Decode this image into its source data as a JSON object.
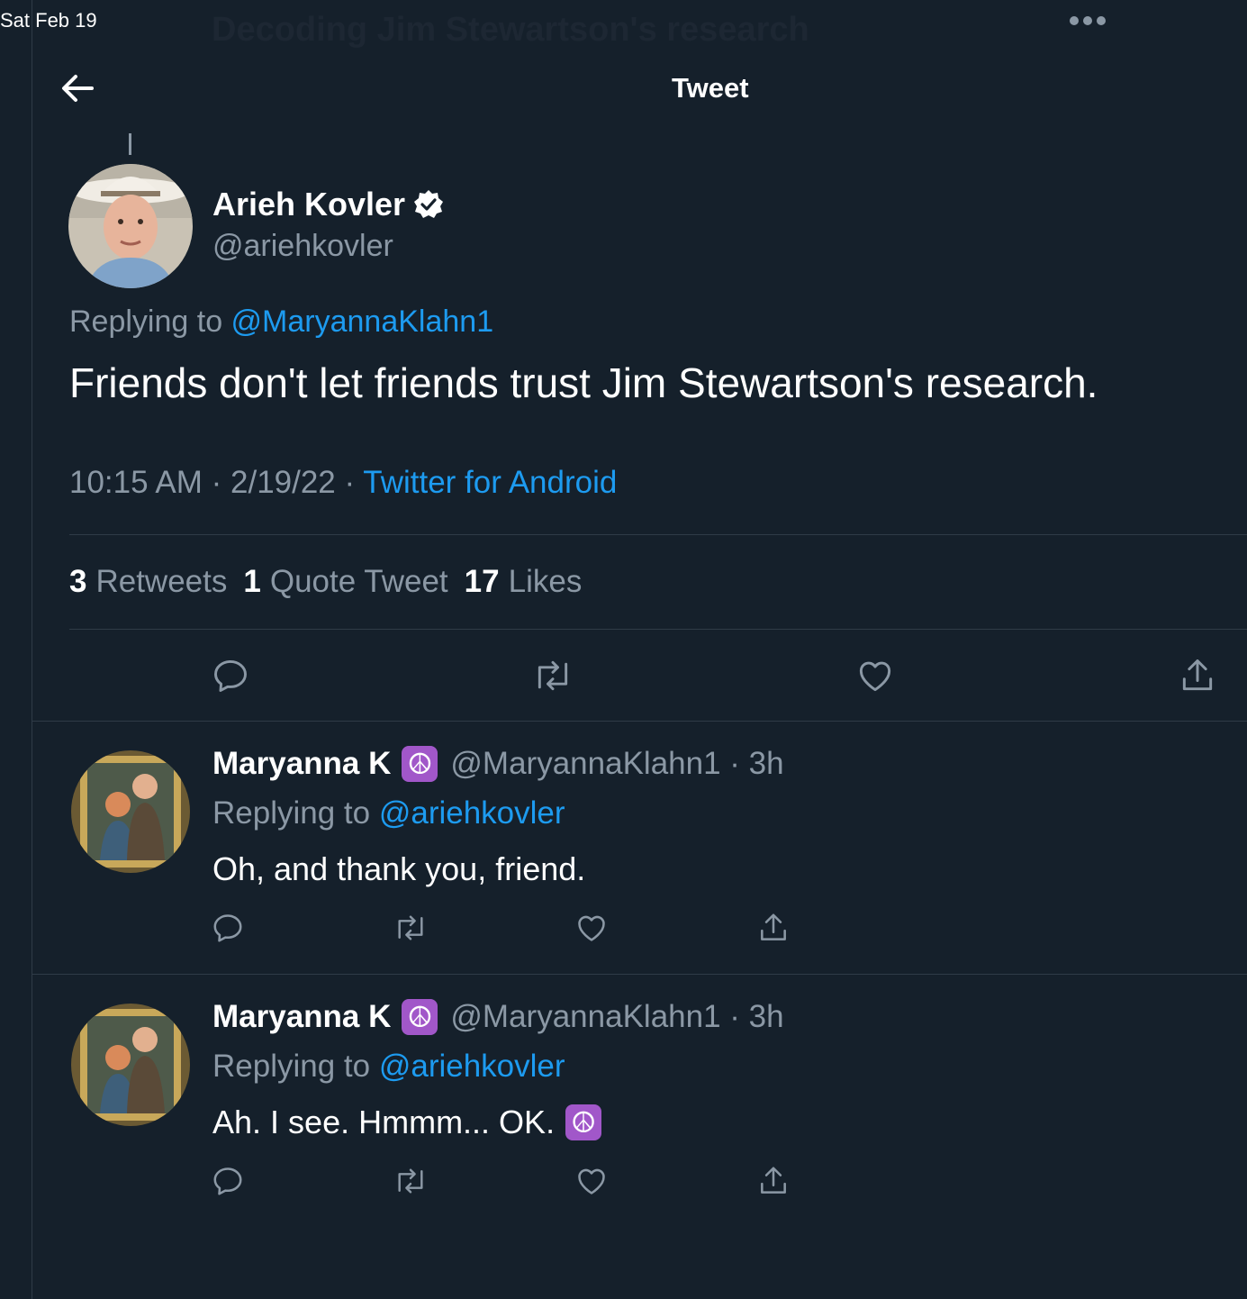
{
  "status_bar": {
    "date": "Sat Feb 19"
  },
  "background_header_text": "Decoding Jim Stewartson's research",
  "header": {
    "title": "Tweet"
  },
  "main_tweet": {
    "author_name": "Arieh Kovler",
    "author_handle": "@ariehkovler",
    "replying_prefix": "Replying to ",
    "replying_to": "@MaryannaKlahn1",
    "text": "Friends don't let friends trust Jim Stewartson's research.",
    "time": "10:15 AM",
    "date": "2/19/22",
    "dot": " · ",
    "source": "Twitter for Android",
    "stats": {
      "retweets_count": "3",
      "retweets_label": "Retweets",
      "quotes_count": "1",
      "quotes_label": "Quote Tweet",
      "likes_count": "17",
      "likes_label": "Likes"
    }
  },
  "replies": [
    {
      "author_name": "Maryanna K",
      "emoji": "☮",
      "handle_time": "@MaryannaKlahn1 · 3h",
      "replying_prefix": "Replying to ",
      "replying_to": "@ariehkovler",
      "text": "Oh, and thank you, friend."
    },
    {
      "author_name": "Maryanna K",
      "emoji": "☮",
      "handle_time": "@MaryannaKlahn1 · 3h",
      "replying_prefix": "Replying to ",
      "replying_to": "@ariehkovler",
      "text": "Ah. I see. Hmmm... OK.",
      "text_emoji": "☮"
    }
  ],
  "colors": {
    "background": "#15202b",
    "accent": "#1d9bf0",
    "muted": "#8b98a5",
    "divider": "#2f3b47",
    "peace_emoji_bg": "#a157c9"
  },
  "icons": [
    "back-arrow-icon",
    "more-icon",
    "verified-badge-icon",
    "reply-icon",
    "retweet-icon",
    "like-icon",
    "share-icon"
  ]
}
